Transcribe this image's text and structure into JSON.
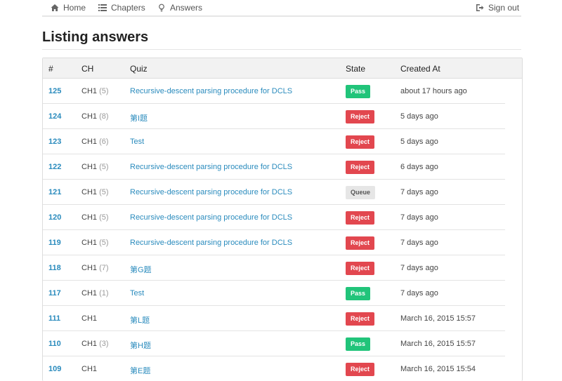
{
  "nav": {
    "home": "Home",
    "chapters": "Chapters",
    "answers": "Answers",
    "signout": "Sign out"
  },
  "page": {
    "title": "Listing answers"
  },
  "table": {
    "headers": {
      "id": "#",
      "ch": "CH",
      "quiz": "Quiz",
      "state": "State",
      "created": "Created At"
    },
    "rows": [
      {
        "id": "125",
        "ch": "CH1",
        "count": "(5)",
        "quiz": "Recursive-descent parsing procedure for DCLS",
        "state": "Pass",
        "created": "about 17 hours ago"
      },
      {
        "id": "124",
        "ch": "CH1",
        "count": "(8)",
        "quiz": "第I题",
        "state": "Reject",
        "created": "5 days ago"
      },
      {
        "id": "123",
        "ch": "CH1",
        "count": "(6)",
        "quiz": "Test",
        "state": "Reject",
        "created": "5 days ago"
      },
      {
        "id": "122",
        "ch": "CH1",
        "count": "(5)",
        "quiz": "Recursive-descent parsing procedure for DCLS",
        "state": "Reject",
        "created": "6 days ago"
      },
      {
        "id": "121",
        "ch": "CH1",
        "count": "(5)",
        "quiz": "Recursive-descent parsing procedure for DCLS",
        "state": "Queue",
        "created": "7 days ago"
      },
      {
        "id": "120",
        "ch": "CH1",
        "count": "(5)",
        "quiz": "Recursive-descent parsing procedure for DCLS",
        "state": "Reject",
        "created": "7 days ago"
      },
      {
        "id": "119",
        "ch": "CH1",
        "count": "(5)",
        "quiz": "Recursive-descent parsing procedure for DCLS",
        "state": "Reject",
        "created": "7 days ago"
      },
      {
        "id": "118",
        "ch": "CH1",
        "count": "(7)",
        "quiz": "第G题",
        "state": "Reject",
        "created": "7 days ago"
      },
      {
        "id": "117",
        "ch": "CH1",
        "count": "(1)",
        "quiz": "Test",
        "state": "Pass",
        "created": "7 days ago"
      },
      {
        "id": "111",
        "ch": "CH1",
        "count": "",
        "quiz": "第L题",
        "state": "Reject",
        "created": "March 16, 2015 15:57"
      },
      {
        "id": "110",
        "ch": "CH1",
        "count": "(3)",
        "quiz": "第H题",
        "state": "Pass",
        "created": "March 16, 2015 15:57"
      },
      {
        "id": "109",
        "ch": "CH1",
        "count": "",
        "quiz": "第E题",
        "state": "Reject",
        "created": "March 16, 2015 15:54"
      }
    ]
  },
  "colors": {
    "link": "#2a8bbd",
    "pass": "#21c47a",
    "reject": "#e2474f",
    "queue": "#e6e6e6"
  }
}
